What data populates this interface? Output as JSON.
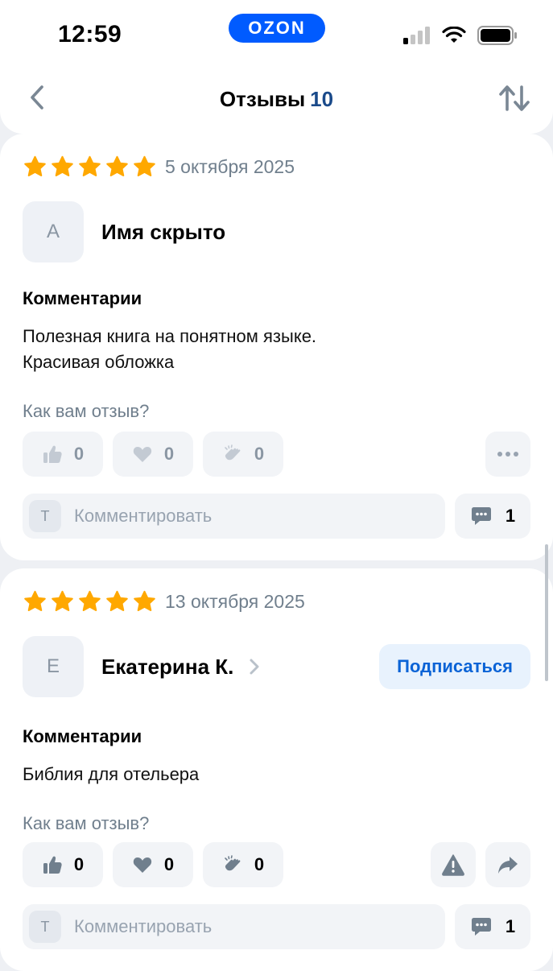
{
  "status_bar": {
    "time": "12:59",
    "badge": "OZON"
  },
  "header": {
    "title": "Отзывы",
    "count": "10"
  },
  "reviews": [
    {
      "rating": 5,
      "date": "5 октября 2025",
      "avatar_letter": "А",
      "author": "Имя скрыто",
      "section_title": "Комментарии",
      "comment_lines": [
        "Полезная книга на понятном языке.",
        "Красивая обложка"
      ],
      "ask": "Как вам отзыв?",
      "likes": "0",
      "hearts": "0",
      "claps": "0",
      "input_avatar": "Т",
      "comment_placeholder": "Комментировать",
      "comments_count": "1"
    },
    {
      "rating": 5,
      "date": "13 октября 2025",
      "avatar_letter": "Е",
      "author": "Екатерина К.",
      "subscribe_label": "Подписаться",
      "section_title": "Комментарии",
      "comment_lines": [
        "Библия для отельера"
      ],
      "ask": "Как вам отзыв?",
      "likes": "0",
      "hearts": "0",
      "claps": "0",
      "input_avatar": "Т",
      "comment_placeholder": "Комментировать",
      "comments_count": "1"
    }
  ],
  "colors": {
    "brand": "#005bff",
    "star": "#ffa800",
    "link": "#0a63d6"
  }
}
